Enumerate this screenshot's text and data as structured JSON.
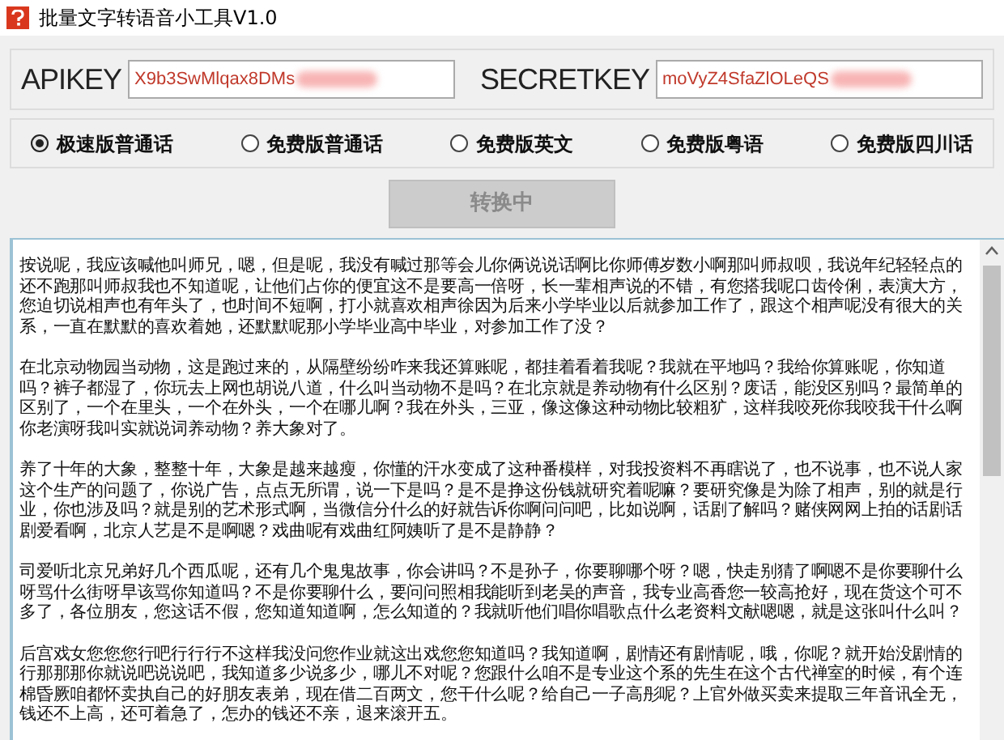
{
  "window": {
    "title": "批量文字转语音小工具V1.0"
  },
  "keys": [
    {
      "label": "APIKEY",
      "value": "X9b3SwMlqax8DMs"
    },
    {
      "label": "SECRETKEY",
      "value": "moVyZ4SfaZlOLeQS"
    }
  ],
  "voices": [
    {
      "label": "极速版普通话",
      "selected": true
    },
    {
      "label": "免费版普通话",
      "selected": false
    },
    {
      "label": "免费版英文",
      "selected": false
    },
    {
      "label": "免费版粤语",
      "selected": false
    },
    {
      "label": "免费版四川话",
      "selected": false
    }
  ],
  "convert_button": {
    "label": "转换中",
    "disabled": true
  },
  "text_area": {
    "paragraphs": [
      "按说呢，我应该喊他叫师兄，嗯，但是呢，我没有喊过那等会儿你俩说说话啊比你师傅岁数小啊那叫师叔呗，我说年纪轻轻点的还不跑那叫师叔我也不知道呢，让他们占你的便宜这不是要高一倍呀，长一辈相声说的不错，有您搭我呢口齿伶俐，表演大方，您迫切说相声也有年头了，也时间不短啊，打小就喜欢相声徐因为后来小学毕业以后就参加工作了，跟这个相声呢没有很大的关系，一直在默默的喜欢着她，还默默呢那小学毕业高中毕业，对参加工作了没？",
      "在北京动物园当动物，这是跑过来的，从隔壁纷纷咋来我还算账呢，都挂着看着我呢？我就在平地吗？我给你算账呢，你知道吗？裤子都湿了，你玩去上网也胡说八道，什么叫当动物不是吗？在北京就是养动物有什么区别？废话，能没区别吗？最简单的区别了，一个在里头，一个在外头，一个在哪儿啊？我在外头，三亚，像这像这种动物比较粗犷，这样我咬死你我咬我干什么啊你老演呀我叫实就说词养动物？养大象对了。",
      "养了十年的大象，整整十年，大象是越来越瘦，你懂的汗水变成了这种番模样，对我投资料不再瞎说了，也不说事，也不说人家这个生产的问题了，你说广告，点点无所谓，说一下是吗？是不是挣这份钱就研究着呢嘛？要研究像是为除了相声，别的就是行业，你也涉及吗？就是别的艺术形式啊，当微信分什么的好就告诉你啊问问吧，比如说啊，话剧了解吗？赌侠网网上拍的话剧话剧爱看啊，北京人艺是不是啊嗯？戏曲呢有戏曲红阿姨听了是不是静静？",
      "司爱听北京兄弟好几个西瓜呢，还有几个鬼鬼故事，你会讲吗？不是孙子，你要聊哪个呀？嗯，快走别猜了啊嗯不是你要聊什么呀骂什么街呀早该骂你知道吗？不是你要聊什么，要问问照相我能听到老吴的声音，我专业高香您一较高抢好，现在货这个可不多了，各位朋友，您这话不假，您知道知道啊，怎么知道的？我就听他们唱你唱歌点什么老资料文献嗯嗯，就是这张叫什么叫？",
      "后宫戏女您您您行吧行行行不这样我没问您作业就这出戏您您知道吗？我知道啊，剧情还有剧情呢，哦，你呢？就开始没剧情的行那那那你就说吧说说吧，我知道多少说多少，哪儿不对呢？您跟什么咱不是专业这个系的先生在这个古代禅室的时候，有个连棉昏厥咱都怀卖执自己的好朋友表弟，现在借二百两文，您干什么呢？给自己一子高彤呢？上官外做买卖来提取三年音讯全无，钱还不上高，还可着急了，怎办的钱还不亲，退来滚开五。"
    ]
  }
}
